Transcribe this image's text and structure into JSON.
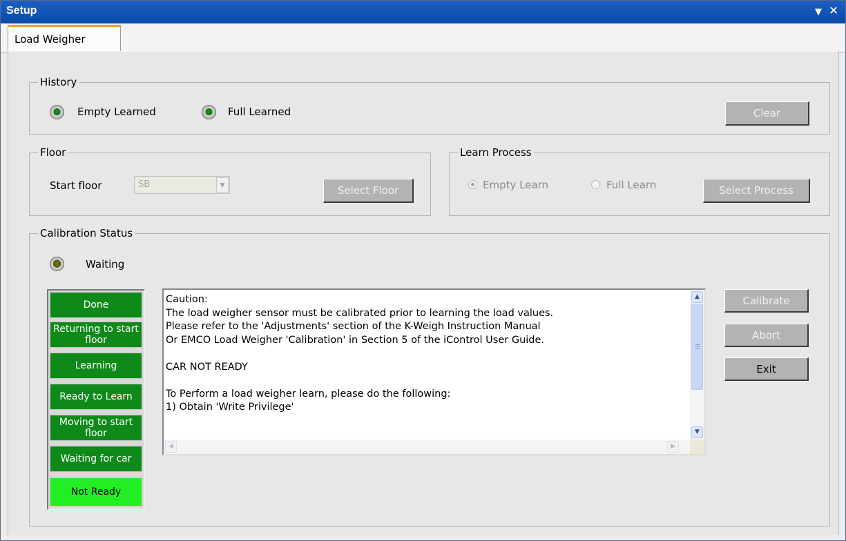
{
  "window": {
    "title": "Setup",
    "menu_glyph": "▼",
    "close_glyph": "✕"
  },
  "tabs": [
    {
      "label": "Load Weigher",
      "selected": true
    }
  ],
  "history": {
    "label": "History",
    "indicators": [
      {
        "label": "Empty Learned",
        "state": "on",
        "icon": "led-green-icon"
      },
      {
        "label": "Full Learned",
        "state": "on",
        "icon": "led-green-icon"
      }
    ],
    "clear_label": "Clear"
  },
  "floor": {
    "label": "Floor",
    "start_floor_label": "Start floor",
    "start_floor_value": "SB",
    "select_label": "Select Floor"
  },
  "learn_process": {
    "label": "Learn Process",
    "options": [
      {
        "label": "Empty Learn",
        "selected": true
      },
      {
        "label": "Full Learn",
        "selected": false
      }
    ],
    "select_label": "Select Process"
  },
  "calibration": {
    "label": "Calibration Status",
    "status_text": "Waiting",
    "status_icon": "led-amber-icon",
    "stages": [
      {
        "label": "Done",
        "active": false
      },
      {
        "label": "Returning to start floor",
        "active": false
      },
      {
        "label": "Learning",
        "active": false
      },
      {
        "label": "Ready to Learn",
        "active": false
      },
      {
        "label": "Moving to start floor",
        "active": false
      },
      {
        "label": "Waiting for car",
        "active": false
      },
      {
        "label": "Not Ready",
        "active": true
      }
    ],
    "message": "Caution:\nThe load weigher sensor must be calibrated prior to learning the load values.\nPlease refer to the 'Adjustments' section of the K-Weigh Instruction Manual\nOr EMCO Load Weigher 'Calibration' in Section 5 of the iControl User Guide.\n\nCAR NOT READY\n\nTo Perform a load weigher learn, please do the following:\n1) Obtain 'Write Privilege'",
    "buttons": {
      "calibrate": "Calibrate",
      "abort": "Abort",
      "exit": "Exit"
    }
  },
  "colors": {
    "titlebar": "#0a4aa8",
    "stage_idle": "#0f8a1a",
    "stage_active": "#22ef22",
    "tab_accent": "#f0a030"
  }
}
